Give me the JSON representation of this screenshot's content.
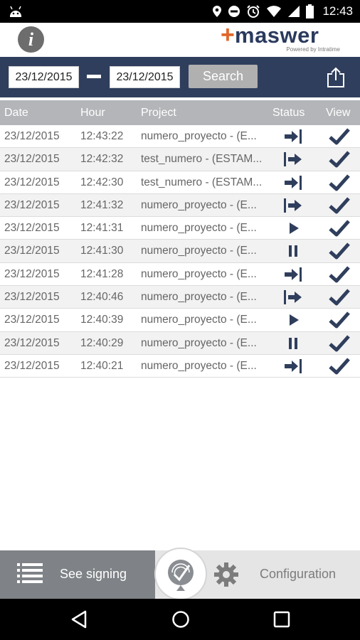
{
  "status_bar": {
    "time": "12:43",
    "icons": [
      "android-icon",
      "location-icon",
      "do-not-disturb-icon",
      "alarm-icon",
      "wifi-icon",
      "signal-icon",
      "battery-icon"
    ]
  },
  "header": {
    "info_label": "i",
    "logo_plus": "+",
    "logo_word": "maswer",
    "logo_tagline": "Powered by Intratime"
  },
  "search": {
    "date_from": "23/12/2015",
    "date_to": "23/12/2015",
    "button_label": "Search"
  },
  "table": {
    "columns": [
      "Date",
      "Hour",
      "Project",
      "Status",
      "View"
    ],
    "rows": [
      {
        "date": "23/12/2015",
        "hour": "12:43:22",
        "project": "numero_proyecto - (E...",
        "status": "exit"
      },
      {
        "date": "23/12/2015",
        "hour": "12:42:32",
        "project": "test_numero - (ESTAM...",
        "status": "enter"
      },
      {
        "date": "23/12/2015",
        "hour": "12:42:30",
        "project": "test_numero - (ESTAM...",
        "status": "exit"
      },
      {
        "date": "23/12/2015",
        "hour": "12:41:32",
        "project": "numero_proyecto - (E...",
        "status": "enter"
      },
      {
        "date": "23/12/2015",
        "hour": "12:41:31",
        "project": "numero_proyecto - (E...",
        "status": "play"
      },
      {
        "date": "23/12/2015",
        "hour": "12:41:30",
        "project": "numero_proyecto - (E...",
        "status": "pause"
      },
      {
        "date": "23/12/2015",
        "hour": "12:41:28",
        "project": "numero_proyecto - (E...",
        "status": "exit"
      },
      {
        "date": "23/12/2015",
        "hour": "12:40:46",
        "project": "numero_proyecto - (E...",
        "status": "enter"
      },
      {
        "date": "23/12/2015",
        "hour": "12:40:39",
        "project": "numero_proyecto - (E...",
        "status": "play"
      },
      {
        "date": "23/12/2015",
        "hour": "12:40:29",
        "project": "numero_proyecto - (E...",
        "status": "pause"
      },
      {
        "date": "23/12/2015",
        "hour": "12:40:21",
        "project": "numero_proyecto - (E...",
        "status": "exit"
      }
    ]
  },
  "bottom_nav": {
    "see_signing_label": "See signing",
    "configuration_label": "Configuration"
  },
  "colors": {
    "navy": "#2f3e5c",
    "orange": "#e0662a",
    "header_gray": "#b3b5b8",
    "nav_active": "#7f8387"
  }
}
